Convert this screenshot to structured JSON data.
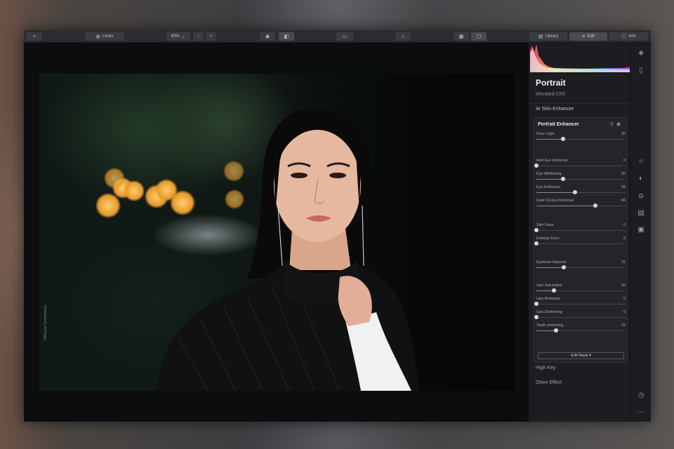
{
  "toolbar": {
    "add_icon": "plus-icon",
    "looks_label": "Looks",
    "zoom_value": "40%",
    "zoom_out": "−",
    "zoom_in": "+",
    "library_label": "Library",
    "edit_label": "Edit",
    "info_label": "Info"
  },
  "photo": {
    "watermark": "©Maryna Yurkevitsova"
  },
  "panel": {
    "title": "Portrait",
    "filename": "elevated.CR2",
    "section_ai": "AI Skin Enhancer",
    "enhancer": {
      "title": "Portrait Enhancer",
      "sliders": [
        {
          "label": "Face Light",
          "value": "30",
          "fraction": 0.3
        },
        {
          "label": "Red Eye Removal",
          "value": "0",
          "fraction": 0.0
        },
        {
          "label": "Eye Whitening",
          "value": "30",
          "fraction": 0.3
        },
        {
          "label": "Eye Enhancer",
          "value": "43",
          "fraction": 0.43
        },
        {
          "label": "Dark Circles Removal",
          "value": "66",
          "fraction": 0.66
        },
        {
          "label": "Slim Face",
          "value": "0",
          "fraction": 0.0
        },
        {
          "label": "Enlarge Eyes",
          "value": "0",
          "fraction": 0.0
        },
        {
          "label": "Eyebrow Improve",
          "value": "31",
          "fraction": 0.31
        },
        {
          "label": "Lips Saturation",
          "value": "20",
          "fraction": 0.2
        },
        {
          "label": "Lips Redness",
          "value": "0",
          "fraction": 0.0
        },
        {
          "label": "Lips Darkening",
          "value": "0",
          "fraction": 0.0
        },
        {
          "label": "Teeth whitening",
          "value": "22",
          "fraction": 0.22
        }
      ],
      "edit_mask": "Edit Mask ▾"
    },
    "footer_items": [
      "High Key",
      "Orton Effect"
    ]
  },
  "sidebar_icons": [
    "layers-icon",
    "compare-icon",
    "sun-icon",
    "palette-icon",
    "portrait-icon",
    "film-icon",
    "briefcase-icon",
    "history-icon",
    "more-icon"
  ]
}
